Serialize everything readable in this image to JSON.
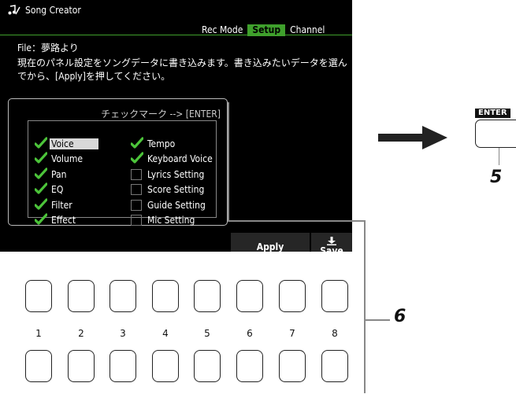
{
  "screen": {
    "app_title": "Song Creator",
    "tabs": [
      {
        "label": "Rec Mode",
        "active": false
      },
      {
        "label": "Setup",
        "active": true
      },
      {
        "label": "Channel",
        "active": false
      }
    ],
    "file_line": "File：夢路より",
    "description": "現在のパネル設定をソングデータに書き込みます。書き込みたいデータを選んでから、[Apply]を押してください。",
    "accent_color": "#3fa02c"
  },
  "dialog": {
    "header": "チェックマーク --> [ENTER]",
    "left_items": [
      {
        "label": "Voice",
        "checked": true,
        "selected": true
      },
      {
        "label": "Volume",
        "checked": true,
        "selected": false
      },
      {
        "label": "Pan",
        "checked": true,
        "selected": false
      },
      {
        "label": "EQ",
        "checked": true,
        "selected": false
      },
      {
        "label": "Filter",
        "checked": true,
        "selected": false
      },
      {
        "label": "Effect",
        "checked": true,
        "selected": false
      }
    ],
    "right_items": [
      {
        "label": "Tempo",
        "checked": true,
        "selected": false
      },
      {
        "label": "Keyboard Voice",
        "checked": true,
        "selected": false
      },
      {
        "label": "Lyrics Setting",
        "checked": false,
        "selected": false
      },
      {
        "label": "Score Setting",
        "checked": false,
        "selected": false
      },
      {
        "label": "Guide Setting",
        "checked": false,
        "selected": false
      },
      {
        "label": "Mic Setting",
        "checked": false,
        "selected": false
      }
    ]
  },
  "softkeys": {
    "apply_label": "Apply",
    "save_label": "Save",
    "save_icon": "download-arrow-icon"
  },
  "panel": {
    "button_numbers": [
      "1",
      "2",
      "3",
      "4",
      "5",
      "6",
      "7",
      "8"
    ]
  },
  "callouts": {
    "step_enter": "5",
    "step_buttons": "6",
    "enter_label": "ENTER"
  }
}
